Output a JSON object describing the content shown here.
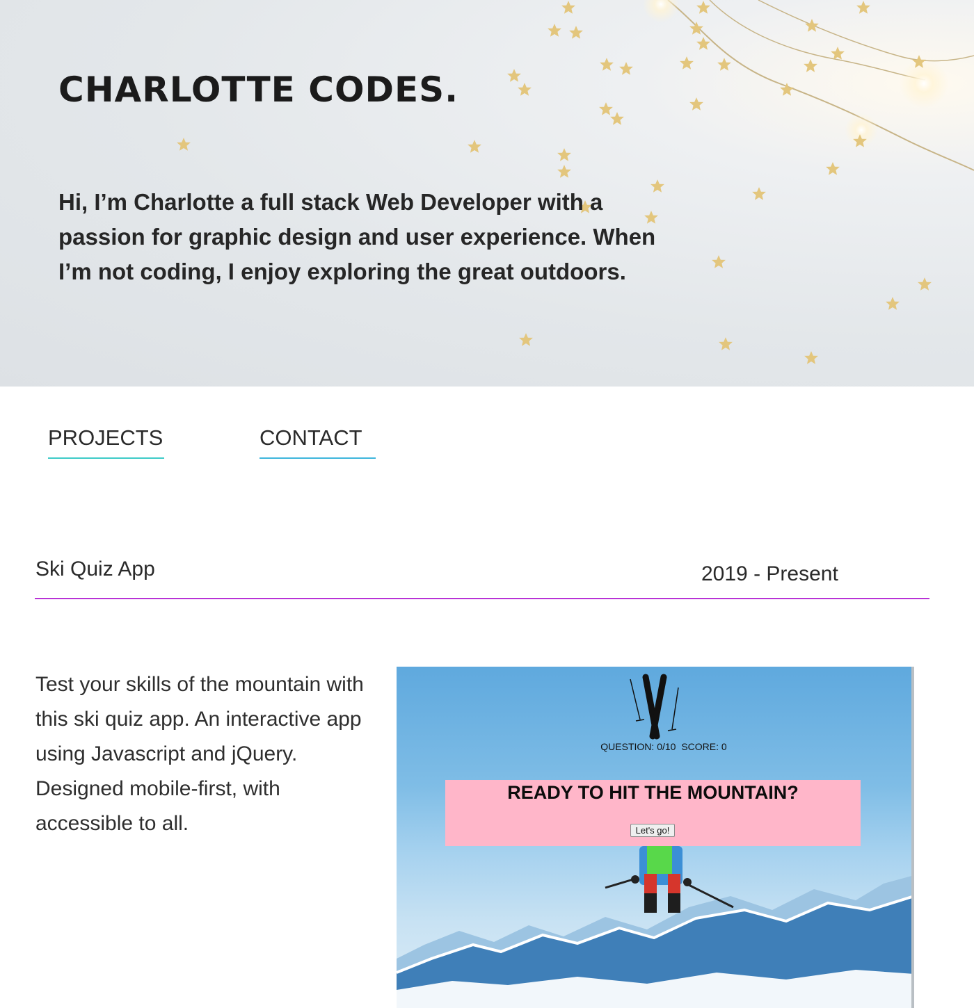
{
  "hero": {
    "title": "CHARLOTTE CODES.",
    "intro": "Hi, I’m Charlotte a full stack Web Developer with a passion for graphic design and user experience. When I’m not coding, I enjoy exploring the great outdoors."
  },
  "nav": {
    "items": [
      {
        "label": "PROJECTS"
      },
      {
        "label": "CONTACT"
      }
    ]
  },
  "projects": [
    {
      "name": "Ski Quiz App",
      "date": "2019 - Present",
      "description": "Test your skills of the mountain with this ski quiz app. An interactive app using Javascript and jQuery. Designed mobile-first, with accessible to all.",
      "screenshot": {
        "question_label": "QUESTION: 0/10",
        "score_label": "SCORE: 0",
        "heading": "READY TO HIT THE MOUNTAIN?",
        "button": "Let's go!"
      }
    }
  ],
  "colors": {
    "projects_underline": "#3fcbc8",
    "contact_underline": "#3fb6dc",
    "project_divider": "#b832d6",
    "quiz_card": "#ffb6c9"
  }
}
